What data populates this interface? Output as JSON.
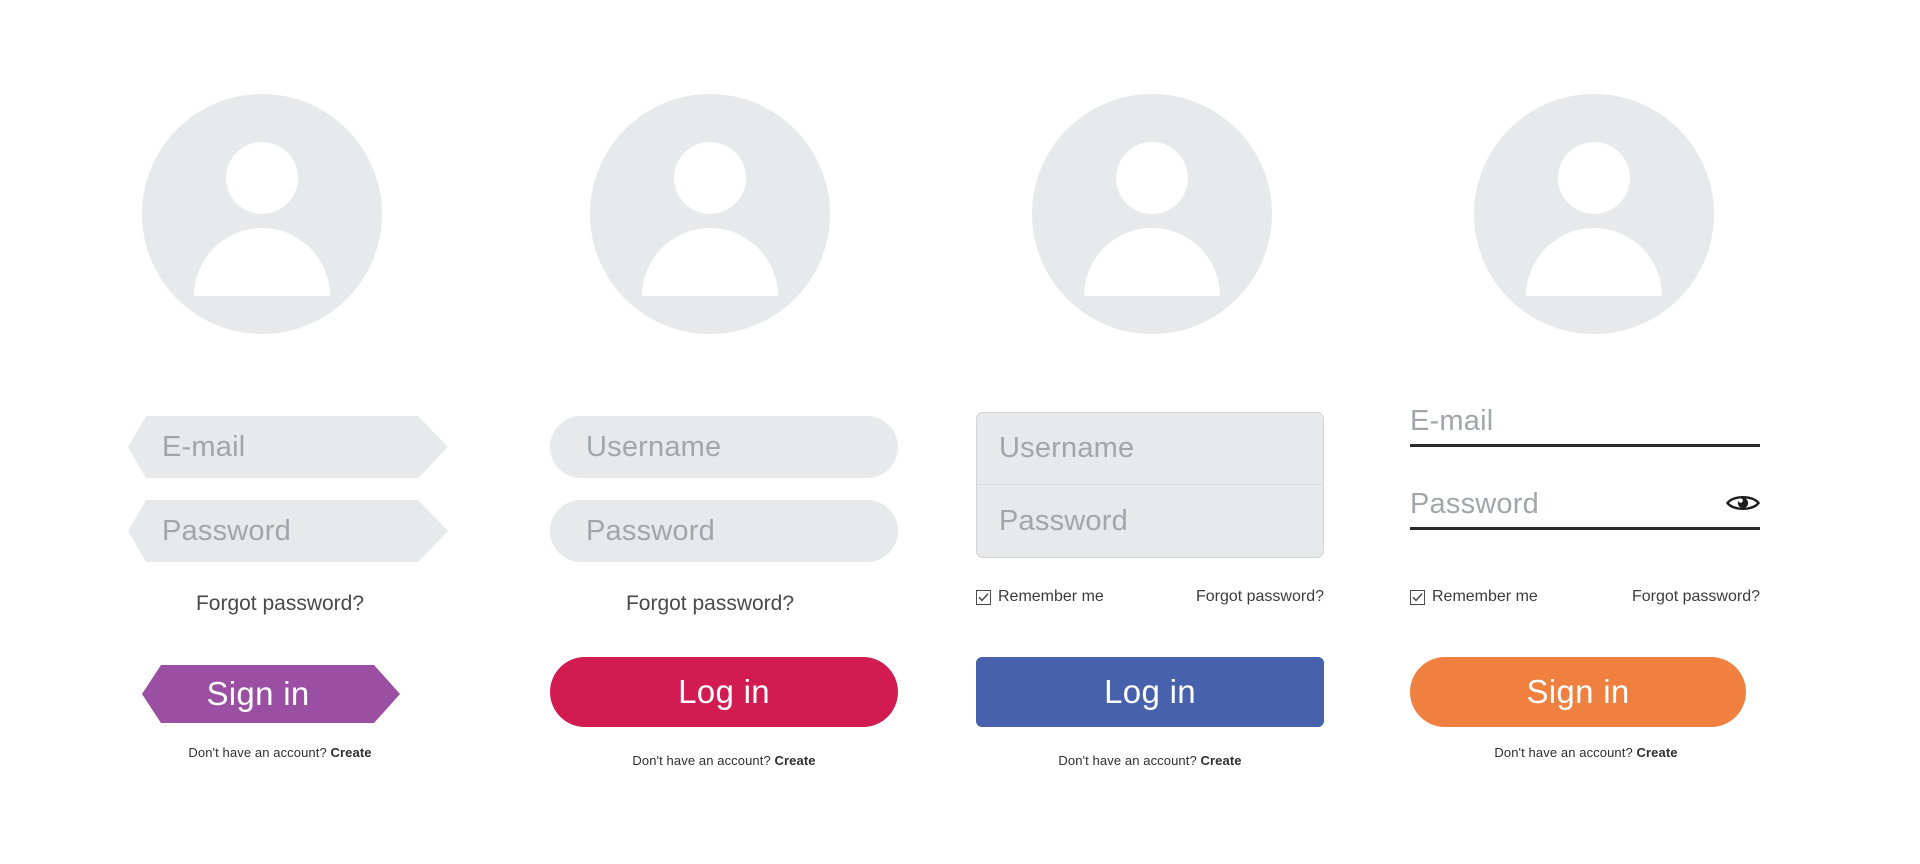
{
  "theme": {
    "background": "#ffffff",
    "field_bg": "#e8e9ea",
    "placeholder_color": "#a2a6ab",
    "avatar_bg": "#e8e9ea",
    "avatar_fg": "#ffffff",
    "text_color": "#3c3c3c",
    "underline_color": "#2b2b2b"
  },
  "common": {
    "forgot_password": "Forgot password?",
    "remember_me": "Remember me",
    "create_prefix": "Don't have an account?",
    "create_link": "Create"
  },
  "forms": [
    {
      "id": "hexagon-login-form",
      "style": "hexagon",
      "accent": "#9a4fa3",
      "avatar": "user-avatar-icon",
      "fields": [
        {
          "name": "email",
          "placeholder": "E-mail",
          "value": ""
        },
        {
          "name": "password",
          "placeholder": "Password",
          "value": ""
        }
      ],
      "forgot_password": "Forgot password?",
      "submit_label": "Sign in",
      "has_remember": false,
      "has_eye": false,
      "create_prefix": "Don't have an account?",
      "create_link": "Create"
    },
    {
      "id": "pill-login-form",
      "style": "pill",
      "accent": "#d21b51",
      "avatar": "user-avatar-icon",
      "fields": [
        {
          "name": "username",
          "placeholder": "Username",
          "value": ""
        },
        {
          "name": "password",
          "placeholder": "Password",
          "value": ""
        }
      ],
      "forgot_password": "Forgot password?",
      "submit_label": "Log in",
      "has_remember": false,
      "has_eye": false,
      "create_prefix": "Don't have an account?",
      "create_link": "Create"
    },
    {
      "id": "grouped-box-login-form",
      "style": "grouped",
      "accent": "#4761ad",
      "avatar": "user-avatar-icon",
      "fields": [
        {
          "name": "username",
          "placeholder": "Username",
          "value": ""
        },
        {
          "name": "password",
          "placeholder": "Password",
          "value": ""
        }
      ],
      "remember_me": "Remember me",
      "remember_checked": true,
      "forgot_password": "Forgot password?",
      "submit_label": "Log in",
      "has_remember": true,
      "has_eye": false,
      "create_prefix": "Don't have an account?",
      "create_link": "Create"
    },
    {
      "id": "underline-login-form",
      "style": "underline",
      "accent": "#ef8040",
      "avatar": "user-avatar-icon",
      "fields": [
        {
          "name": "email",
          "placeholder": "E-mail",
          "value": ""
        },
        {
          "name": "password",
          "placeholder": "Password",
          "value": ""
        }
      ],
      "remember_me": "Remember me",
      "remember_checked": true,
      "forgot_password": "Forgot password?",
      "submit_label": "Sign in",
      "has_remember": true,
      "has_eye": true,
      "eye_icon": "show-password-eye-icon",
      "create_prefix": "Don't have an account?",
      "create_link": "Create"
    }
  ]
}
